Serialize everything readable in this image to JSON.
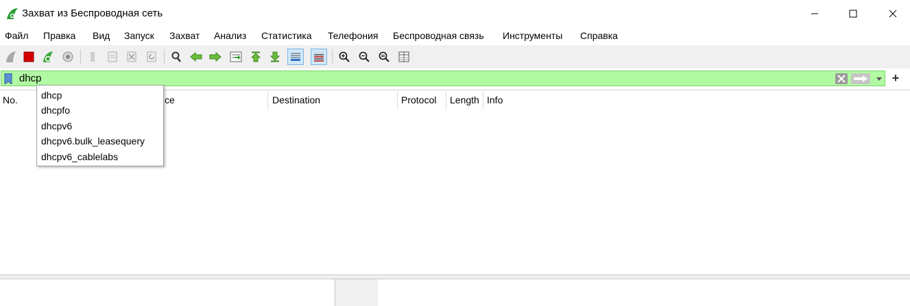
{
  "window": {
    "title": "Захват из Беспроводная сеть",
    "icon": "wireshark-fin-icon"
  },
  "menu": [
    "Файл",
    "Правка",
    "Вид",
    "Запуск",
    "Захват",
    "Анализ",
    "Статистика",
    "Телефония",
    "Беспроводная связь",
    "Инструменты",
    "Справка"
  ],
  "toolbar": {
    "icons": [
      "start-capture-icon",
      "stop-capture-icon",
      "restart-capture-icon",
      "capture-options-icon",
      "open-file-icon",
      "save-file-icon",
      "close-file-icon",
      "reload-file-icon",
      "find-packet-icon",
      "go-back-icon",
      "go-forward-icon",
      "go-to-packet-icon",
      "go-first-packet-icon",
      "go-last-packet-icon",
      "autoscroll-icon",
      "colorize-icon",
      "zoom-in-icon",
      "zoom-out-icon",
      "zoom-normal-icon",
      "resize-columns-icon"
    ]
  },
  "filter": {
    "value": "dhcp",
    "background": "#b1f9a2"
  },
  "autocomplete": {
    "items": [
      "dhcp",
      "dhcpfo",
      "dhcpv6",
      "dhcpv6.bulk_leasequery",
      "dhcpv6_cablelabs"
    ]
  },
  "packet_list": {
    "columns": [
      "No.",
      "ce",
      "Destination",
      "Protocol",
      "Length",
      "Info"
    ]
  },
  "colors": {
    "accent": "#0078d7",
    "filter_valid": "#b1f9a2",
    "capture_stop": "#d40000",
    "capture_restart": "#3fa53a"
  }
}
